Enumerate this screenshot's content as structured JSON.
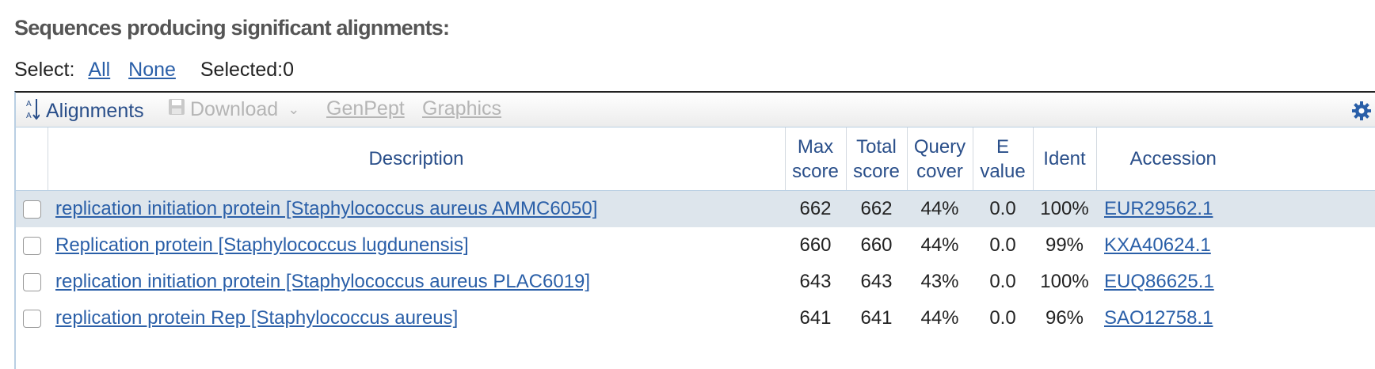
{
  "heading": "Sequences producing significant alignments:",
  "select": {
    "label": "Select:",
    "all": "All",
    "none": "None",
    "selected": "Selected:0"
  },
  "toolbar": {
    "alignments": "Alignments",
    "download": "Download",
    "genpept": "GenPept",
    "graphics": "Graphics",
    "alignments_icon": "sort-az-icon",
    "download_icon": "floppy-disk-icon",
    "settings_icon": "gear-icon"
  },
  "table": {
    "headers": {
      "description": "Description",
      "max_score_1": "Max",
      "max_score_2": "score",
      "total_score_1": "Total",
      "total_score_2": "score",
      "query_cover_1": "Query",
      "query_cover_2": "cover",
      "evalue_1": "E",
      "evalue_2": "value",
      "ident": "Ident",
      "accession": "Accession"
    },
    "rows": [
      {
        "description": "replication initiation protein [Staphylococcus aureus AMMC6050]",
        "max_score": "662",
        "total_score": "662",
        "query_cover": "44%",
        "evalue": "0.0",
        "ident": "100%",
        "accession": "EUR29562.1"
      },
      {
        "description": "Replication protein [Staphylococcus lugdunensis]",
        "max_score": "660",
        "total_score": "660",
        "query_cover": "44%",
        "evalue": "0.0",
        "ident": "99%",
        "accession": "KXA40624.1"
      },
      {
        "description": "replication initiation protein [Staphylococcus aureus PLAC6019]",
        "max_score": "643",
        "total_score": "643",
        "query_cover": "43%",
        "evalue": "0.0",
        "ident": "100%",
        "accession": "EUQ86625.1"
      },
      {
        "description": "replication protein Rep [Staphylococcus aureus]",
        "max_score": "641",
        "total_score": "641",
        "query_cover": "44%",
        "evalue": "0.0",
        "ident": "96%",
        "accession": "SAO12758.1"
      }
    ]
  },
  "colors": {
    "link": "#2a5fa8",
    "header_text": "#2a4f8a",
    "highlight_row": "#dde5ec",
    "disabled": "#b5b5b5"
  }
}
